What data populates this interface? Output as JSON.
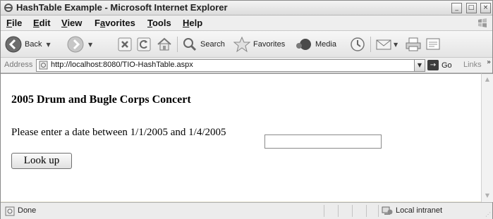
{
  "window": {
    "title": "HashTable Example - Microsoft Internet Explorer",
    "controls": {
      "minimize": "_",
      "maximize": "□",
      "close": "×"
    }
  },
  "menubar": {
    "items": [
      {
        "label": "File",
        "accel": "F",
        "rest": "ile"
      },
      {
        "label": "Edit",
        "accel": "E",
        "rest": "dit"
      },
      {
        "label": "View",
        "accel": "V",
        "rest": "iew"
      },
      {
        "label": "Favorites",
        "accel": "a",
        "pre": "F",
        "rest": "vorites"
      },
      {
        "label": "Tools",
        "accel": "T",
        "rest": "ools"
      },
      {
        "label": "Help",
        "accel": "H",
        "rest": "elp"
      }
    ]
  },
  "toolbar": {
    "back_label": "Back",
    "search_label": "Search",
    "favorites_label": "Favorites",
    "media_label": "Media",
    "dropdown_glyph": "▼"
  },
  "address": {
    "label": "Address",
    "url": "http://localhost:8080/TIO-HashTable.aspx",
    "go_label": "Go",
    "go_glyph": "→",
    "links_label": "Links",
    "links_more": "»",
    "dropdown_glyph": "▼"
  },
  "page": {
    "heading": "2005 Drum and Bugle Corps Concert",
    "prompt": "Please enter a date between 1/1/2005 and 1/4/2005",
    "date_value": "",
    "button_label": "Look up"
  },
  "scrollbar": {
    "up_glyph": "▲",
    "down_glyph": "▼"
  },
  "status": {
    "text": "Done",
    "zone": "Local intranet",
    "grip": "⋰"
  },
  "colors": {
    "titlebar": "#e6e6e6",
    "content_bg": "#ffffff",
    "chrome_bg": "#ececec"
  }
}
